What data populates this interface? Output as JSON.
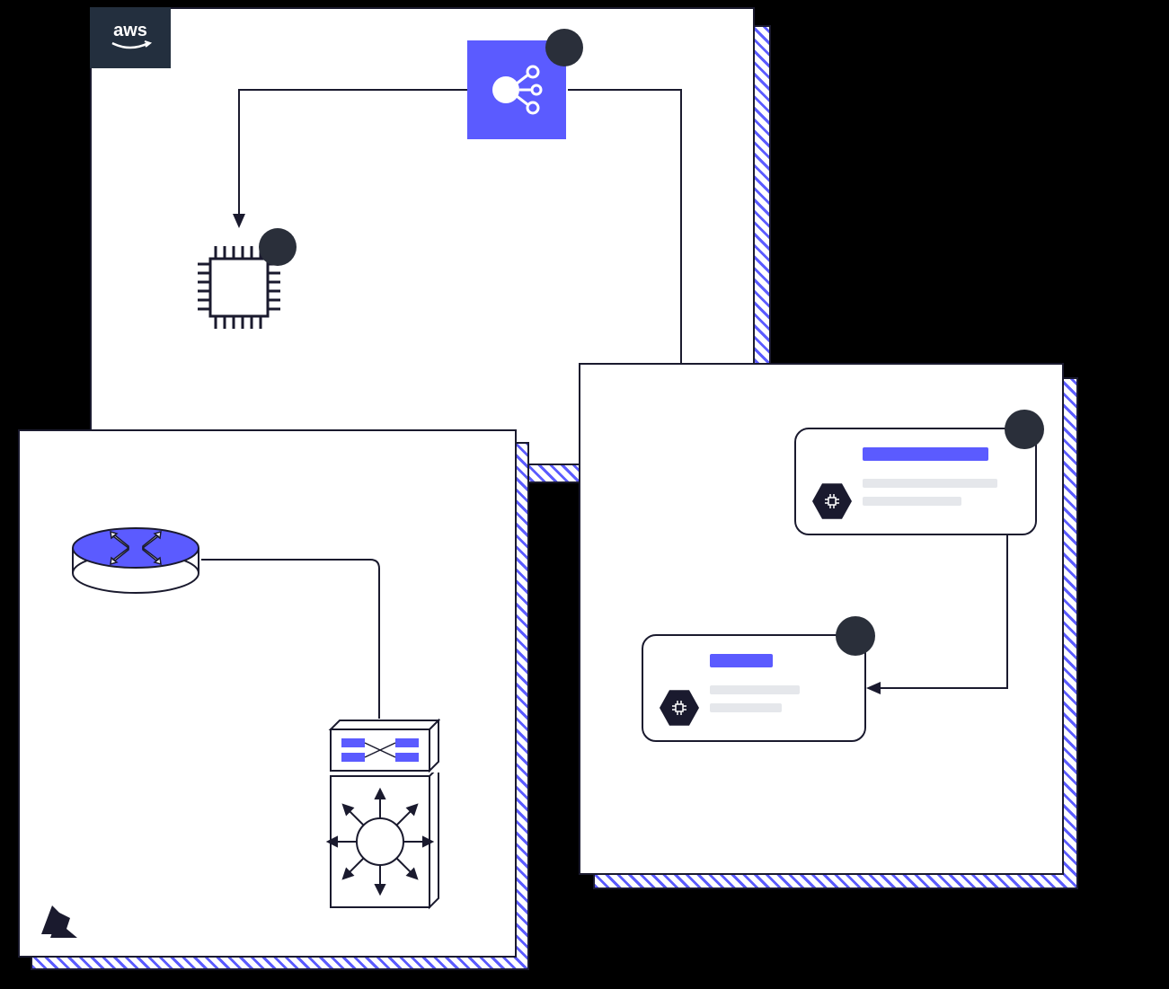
{
  "colors": {
    "accent": "#5b5bff",
    "dark": "#1a1a2e",
    "dot": "#2a2f3a",
    "skeleton": "#e5e7eb",
    "awsBg": "#232f3e"
  },
  "panels": {
    "top": {
      "provider": "aws",
      "badgeText": "aws",
      "icons": {
        "share": {
          "name": "share-node-icon",
          "hasDot": true
        },
        "cpu": {
          "name": "cpu-chip-icon",
          "hasDot": true
        }
      }
    },
    "bottomLeft": {
      "provider": "azure",
      "icons": {
        "router": {
          "name": "router-disc-icon"
        },
        "switch": {
          "name": "network-switch-icon"
        },
        "hub": {
          "name": "hub-star-icon"
        }
      }
    },
    "right": {
      "cards": [
        {
          "hasDot": true,
          "hexIcon": "chip-hex-icon",
          "titleWidth": 140,
          "lines": [
            150,
            110
          ]
        },
        {
          "hasDot": true,
          "hexIcon": "chip-hex-icon",
          "titleWidth": 70,
          "lines": [
            100,
            80
          ]
        }
      ]
    }
  }
}
